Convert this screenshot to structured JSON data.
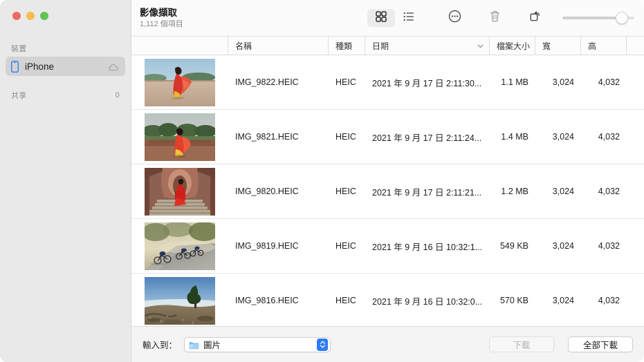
{
  "window": {
    "traffic_lights": [
      {
        "name": "close",
        "color": "#ED6A5E"
      },
      {
        "name": "minimize",
        "color": "#F5BD4F"
      },
      {
        "name": "zoom",
        "color": "#61C555"
      }
    ]
  },
  "sidebar": {
    "devices_header": "裝置",
    "device": {
      "label": "iPhone",
      "icon": "iphone-icon",
      "status_icon": "cloud-icon",
      "selected": true
    },
    "shared_header": "共享",
    "shared_count": "0"
  },
  "header": {
    "title": "影像擷取",
    "subtitle": "1,112 個項目"
  },
  "toolbar": {
    "items": [
      {
        "name": "grid-view-button",
        "icon": "grid-icon",
        "active": true
      },
      {
        "name": "list-view-button",
        "icon": "list-icon",
        "active": false
      },
      {
        "name": "more-options-button",
        "icon": "ellipsis-circle-icon",
        "active": false
      },
      {
        "name": "delete-button",
        "icon": "trash-icon",
        "active": false
      },
      {
        "name": "rotate-button",
        "icon": "rotate-icon",
        "active": false
      }
    ],
    "zoom_slider": {
      "name": "thumbnail-size-slider",
      "value": 82
    }
  },
  "table": {
    "columns": [
      {
        "key": "thumbnail",
        "label": ""
      },
      {
        "key": "name",
        "label": "名稱"
      },
      {
        "key": "kind",
        "label": "種類"
      },
      {
        "key": "date",
        "label": "日期",
        "sorted": true,
        "sort_icon": "chevron-down-icon"
      },
      {
        "key": "size",
        "label": "檔案大小"
      },
      {
        "key": "width",
        "label": "寬"
      },
      {
        "key": "height",
        "label": "高"
      }
    ],
    "rows": [
      {
        "name": "IMG_9822.HEIC",
        "kind": "HEIC",
        "date": "2021 年 9 月 17 日 2:11:30...",
        "size": "1.1 MB",
        "width": "3,024",
        "height": "4,032",
        "thumb": "woman-red-sari-terrace"
      },
      {
        "name": "IMG_9821.HEIC",
        "kind": "HEIC",
        "date": "2021 年 9 月 17 日 2:11:24...",
        "size": "1.4 MB",
        "width": "3,024",
        "height": "4,032",
        "thumb": "woman-red-sari-garden"
      },
      {
        "name": "IMG_9820.HEIC",
        "kind": "HEIC",
        "date": "2021 年 9 月 17 日 2:11:21...",
        "size": "1.2 MB",
        "width": "3,024",
        "height": "4,032",
        "thumb": "woman-red-dress-stairs"
      },
      {
        "name": "IMG_9819.HEIC",
        "kind": "HEIC",
        "date": "2021 年 9 月 16 日 10:32:1...",
        "size": "549 KB",
        "width": "3,024",
        "height": "4,032",
        "thumb": "cyclists-misty-road"
      },
      {
        "name": "IMG_9816.HEIC",
        "kind": "HEIC",
        "date": "2021 年 9 月 16 日 10:32:0...",
        "size": "570 KB",
        "width": "3,024",
        "height": "4,032",
        "thumb": "coastal-ridge-pine"
      }
    ]
  },
  "bottom_bar": {
    "import_label": "輸入到：",
    "destination": {
      "value": "圖片",
      "icon": "folder-icon"
    },
    "download_button": {
      "label": "下載",
      "disabled": true
    },
    "download_all_button": {
      "label": "全部下載",
      "disabled": false
    }
  }
}
